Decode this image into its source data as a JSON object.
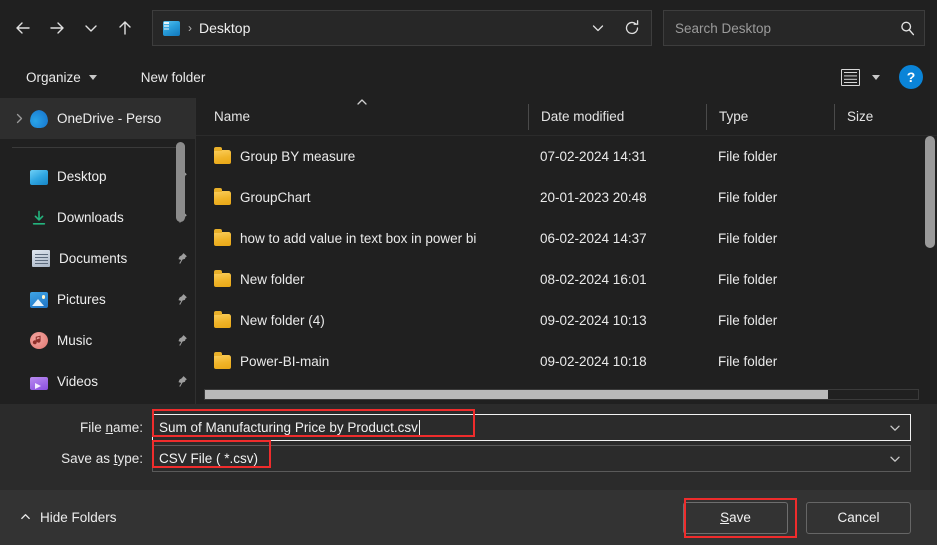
{
  "navbar": {
    "back_icon": "arrow-left-icon",
    "forward_icon": "arrow-right-icon",
    "recent_icon": "chevron-down-icon",
    "up_icon": "arrow-up-icon",
    "address": {
      "location_icon": "desktop-icon",
      "separator": "›",
      "path": "Desktop",
      "dropdown_icon": "chevron-down-icon",
      "refresh_icon": "refresh-icon"
    },
    "search": {
      "placeholder": "Search Desktop",
      "value": "",
      "icon": "search-icon"
    }
  },
  "command_bar": {
    "organize_label": "Organize",
    "new_folder_label": "New folder",
    "view_icon": "details-view-icon",
    "view_caret_icon": "caret-down-icon",
    "help_label": "?",
    "help_icon": "help-icon"
  },
  "sidebar": {
    "tree_item": {
      "label": "OneDrive - Perso",
      "icon": "onedrive-icon",
      "expander_icon": "chevron-right-icon"
    },
    "quick_access": [
      {
        "label": "Desktop",
        "icon": "desktop-icon",
        "pin": "pin-icon"
      },
      {
        "label": "Downloads",
        "icon": "downloads-icon",
        "pin": "pin-icon"
      },
      {
        "label": "Documents",
        "icon": "documents-icon",
        "pin": "pin-icon"
      },
      {
        "label": "Pictures",
        "icon": "pictures-icon",
        "pin": "pin-icon"
      },
      {
        "label": "Music",
        "icon": "music-icon",
        "pin": "pin-icon"
      },
      {
        "label": "Videos",
        "icon": "videos-icon",
        "pin": "pin-icon"
      }
    ]
  },
  "file_list": {
    "columns": [
      "Name",
      "Date modified",
      "Type",
      "Size"
    ],
    "sort_column": "Name",
    "sort_icon": "sort-ascending-icon",
    "rows": [
      {
        "name": "Group BY measure",
        "date": "07-02-2024 14:31",
        "type": "File folder",
        "size": "",
        "icon": "folder-icon"
      },
      {
        "name": "GroupChart",
        "date": "20-01-2023 20:48",
        "type": "File folder",
        "size": "",
        "icon": "folder-icon"
      },
      {
        "name": "how to add value in text box in power bi",
        "date": "06-02-2024 14:37",
        "type": "File folder",
        "size": "",
        "icon": "folder-icon"
      },
      {
        "name": "New folder",
        "date": "08-02-2024 16:01",
        "type": "File folder",
        "size": "",
        "icon": "folder-icon"
      },
      {
        "name": "New folder (4)",
        "date": "09-02-2024 10:13",
        "type": "File folder",
        "size": "",
        "icon": "folder-icon"
      },
      {
        "name": "Power-BI-main",
        "date": "09-02-2024 10:18",
        "type": "File folder",
        "size": "",
        "icon": "folder-icon"
      }
    ]
  },
  "form": {
    "file_name": {
      "label_before": "File ",
      "label_mnemonic": "n",
      "label_after": "ame:",
      "value": "Sum of Manufacturing Price by Product.csv",
      "dropdown_icon": "chevron-down-icon"
    },
    "save_as_type": {
      "label_before": "Save as ",
      "label_mnemonic": "t",
      "label_after": "ype:",
      "value": "CSV File  ( *.csv)",
      "dropdown_icon": "chevron-down-icon"
    }
  },
  "footer": {
    "hide_folders_label": "Hide Folders",
    "hide_folders_icon": "chevron-up-icon",
    "save_label_before": "",
    "save_mnemonic": "S",
    "save_label_after": "ave",
    "cancel_label": "Cancel"
  },
  "annotations": {
    "highlight_color": "#ef2c2c",
    "targets": [
      "file-name-field",
      "save-as-type-value",
      "save-button"
    ]
  }
}
